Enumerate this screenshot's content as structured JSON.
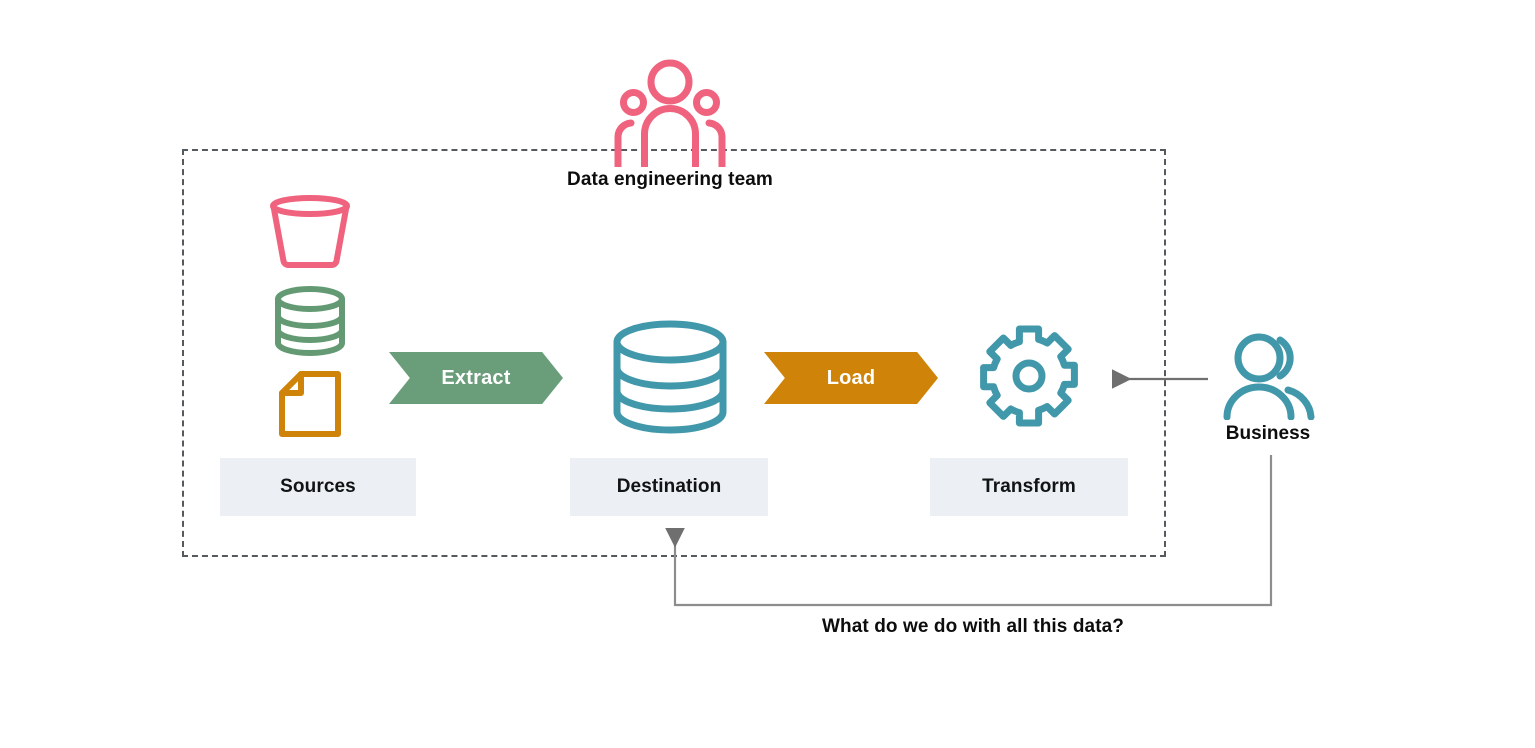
{
  "diagram": {
    "title": "Data engineering team",
    "bottom_caption": "What do we do with all this data?",
    "colors": {
      "pink": "#f0637e",
      "green": "#6a9e7b",
      "orange": "#cf8409",
      "teal": "#4198aa",
      "box_bg": "#eceff3",
      "boundary": "#555a5e",
      "connector": "#7a7a7a"
    }
  },
  "stages": {
    "sources": {
      "label": "Sources",
      "icons": [
        {
          "name": "bucket-icon",
          "color": "#f0637e"
        },
        {
          "name": "database-icon",
          "color": "#6a9e7b"
        },
        {
          "name": "document-icon",
          "color": "#cf8409"
        }
      ]
    },
    "destination": {
      "label": "Destination",
      "icon": {
        "name": "database-icon",
        "color": "#4198aa"
      }
    },
    "transform": {
      "label": "Transform",
      "icon": {
        "name": "gear-icon",
        "color": "#4198aa"
      }
    }
  },
  "arrows": {
    "extract": {
      "label": "Extract",
      "color": "#6a9e7b"
    },
    "load": {
      "label": "Load",
      "color": "#cf8409"
    }
  },
  "actors": {
    "team": {
      "icon": "people-group-icon",
      "color": "#f0637e"
    },
    "business": {
      "label": "Business",
      "icon": "people-icon",
      "color": "#4198aa"
    }
  }
}
